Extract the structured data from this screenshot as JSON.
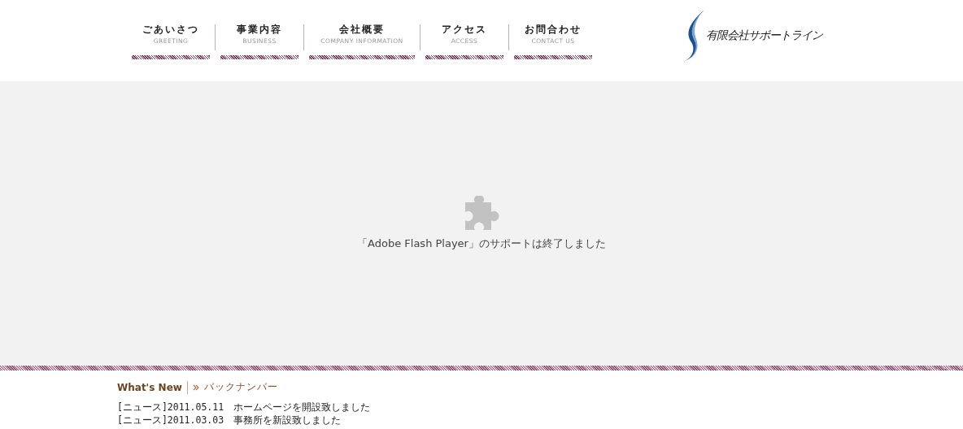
{
  "nav": [
    {
      "label": "ごあいさつ",
      "sublabel": "GREETING"
    },
    {
      "label": "事業内容",
      "sublabel": "BUSINESS"
    },
    {
      "label": "会社概要",
      "sublabel": "COMPANY INFORMATION"
    },
    {
      "label": "アクセス",
      "sublabel": "ACCESS"
    },
    {
      "label": "お問合わせ",
      "sublabel": "CONTACT US"
    }
  ],
  "logo": {
    "text": "有限会社サポートライン"
  },
  "plugin_notice": {
    "message": "「Adobe Flash Player」のサポートは終了しました"
  },
  "news": {
    "title": "What's New",
    "archive_link": "バックナンバー",
    "items": [
      "[ニュース]2011.05.11　ホームページを開設致しました",
      "[ニュース]2011.03.03　事務所を新設致しました"
    ]
  }
}
